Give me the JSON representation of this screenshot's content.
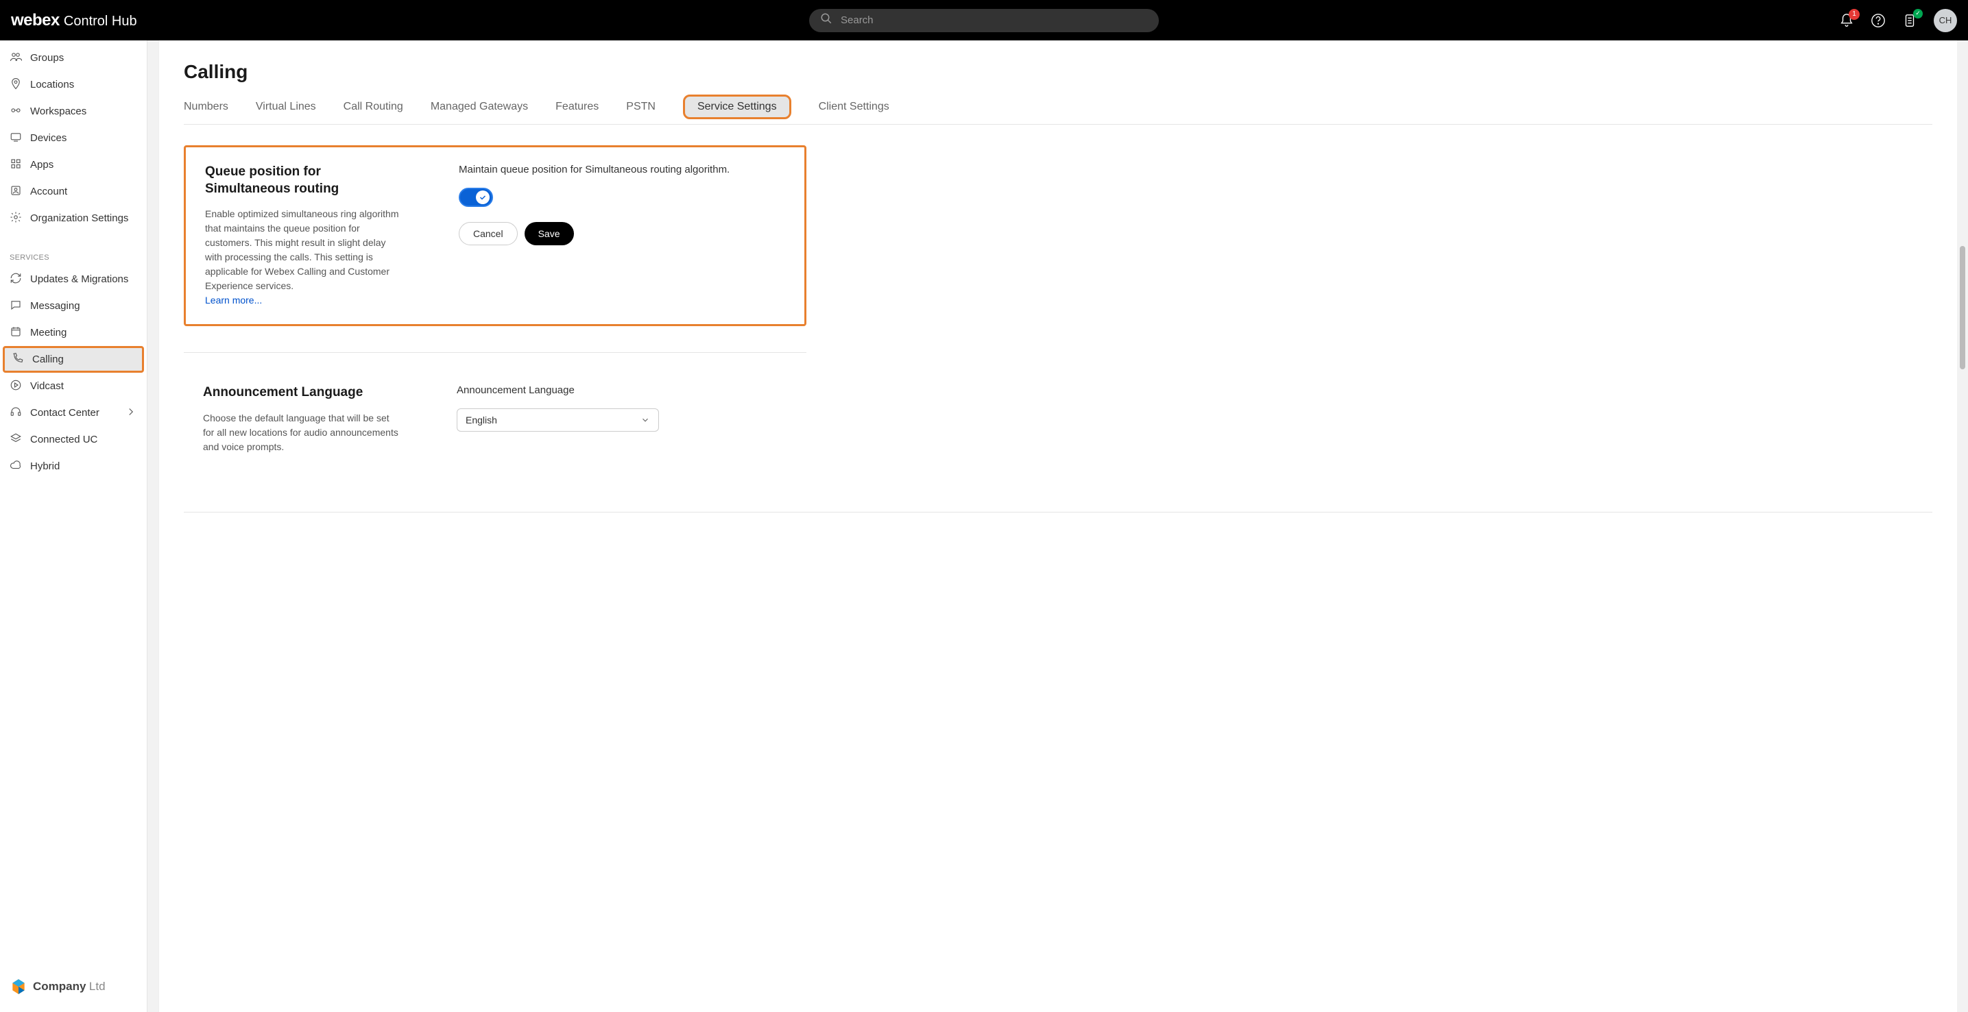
{
  "header": {
    "logo_main": "webex",
    "logo_sub": "Control Hub",
    "search_placeholder": "Search",
    "notification_badge": "1",
    "avatar_initials": "CH"
  },
  "sidebar": {
    "top_items": [
      {
        "id": "groups",
        "label": "Groups",
        "icon": "users"
      },
      {
        "id": "locations",
        "label": "Locations",
        "icon": "pin"
      },
      {
        "id": "workspaces",
        "label": "Workspaces",
        "icon": "workspace"
      },
      {
        "id": "devices",
        "label": "Devices",
        "icon": "device"
      },
      {
        "id": "apps",
        "label": "Apps",
        "icon": "grid"
      },
      {
        "id": "account",
        "label": "Account",
        "icon": "account"
      },
      {
        "id": "orgsettings",
        "label": "Organization Settings",
        "icon": "gear"
      }
    ],
    "section_label": "SERVICES",
    "service_items": [
      {
        "id": "updates",
        "label": "Updates & Migrations",
        "icon": "refresh"
      },
      {
        "id": "messaging",
        "label": "Messaging",
        "icon": "message"
      },
      {
        "id": "meeting",
        "label": "Meeting",
        "icon": "calendar"
      },
      {
        "id": "calling",
        "label": "Calling",
        "icon": "phone",
        "selected": true
      },
      {
        "id": "vidcast",
        "label": "Vidcast",
        "icon": "play"
      },
      {
        "id": "contactcenter",
        "label": "Contact Center",
        "icon": "headset",
        "chevron": true
      },
      {
        "id": "connecteduc",
        "label": "Connected UC",
        "icon": "stack"
      },
      {
        "id": "hybrid",
        "label": "Hybrid",
        "icon": "cloud"
      }
    ],
    "company_name": "Company",
    "company_suffix": "Ltd"
  },
  "page": {
    "title": "Calling",
    "tabs": [
      {
        "id": "numbers",
        "label": "Numbers"
      },
      {
        "id": "virtuallines",
        "label": "Virtual Lines"
      },
      {
        "id": "callrouting",
        "label": "Call Routing"
      },
      {
        "id": "gateways",
        "label": "Managed Gateways"
      },
      {
        "id": "features",
        "label": "Features"
      },
      {
        "id": "pstn",
        "label": "PSTN"
      },
      {
        "id": "servicesettings",
        "label": "Service Settings",
        "active": true
      },
      {
        "id": "clientsettings",
        "label": "Client Settings"
      }
    ]
  },
  "queue_card": {
    "title": "Queue position for Simultaneous routing",
    "description": "Enable optimized simultaneous ring algorithm that maintains the queue position for customers. This might result in slight delay with processing the calls. This setting is applicable for Webex Calling and Customer Experience services.",
    "learn_more": "Learn more...",
    "right_label": "Maintain queue position for Simultaneous routing algorithm.",
    "toggle_on": true,
    "cancel_label": "Cancel",
    "save_label": "Save"
  },
  "lang_card": {
    "title": "Announcement Language",
    "description": "Choose the default language that will be set for all new locations for audio announcements and voice prompts.",
    "right_label": "Announcement Language",
    "selected_value": "English"
  },
  "colors": {
    "highlight_border": "#e8802e",
    "primary_blue": "#0a62d6"
  }
}
